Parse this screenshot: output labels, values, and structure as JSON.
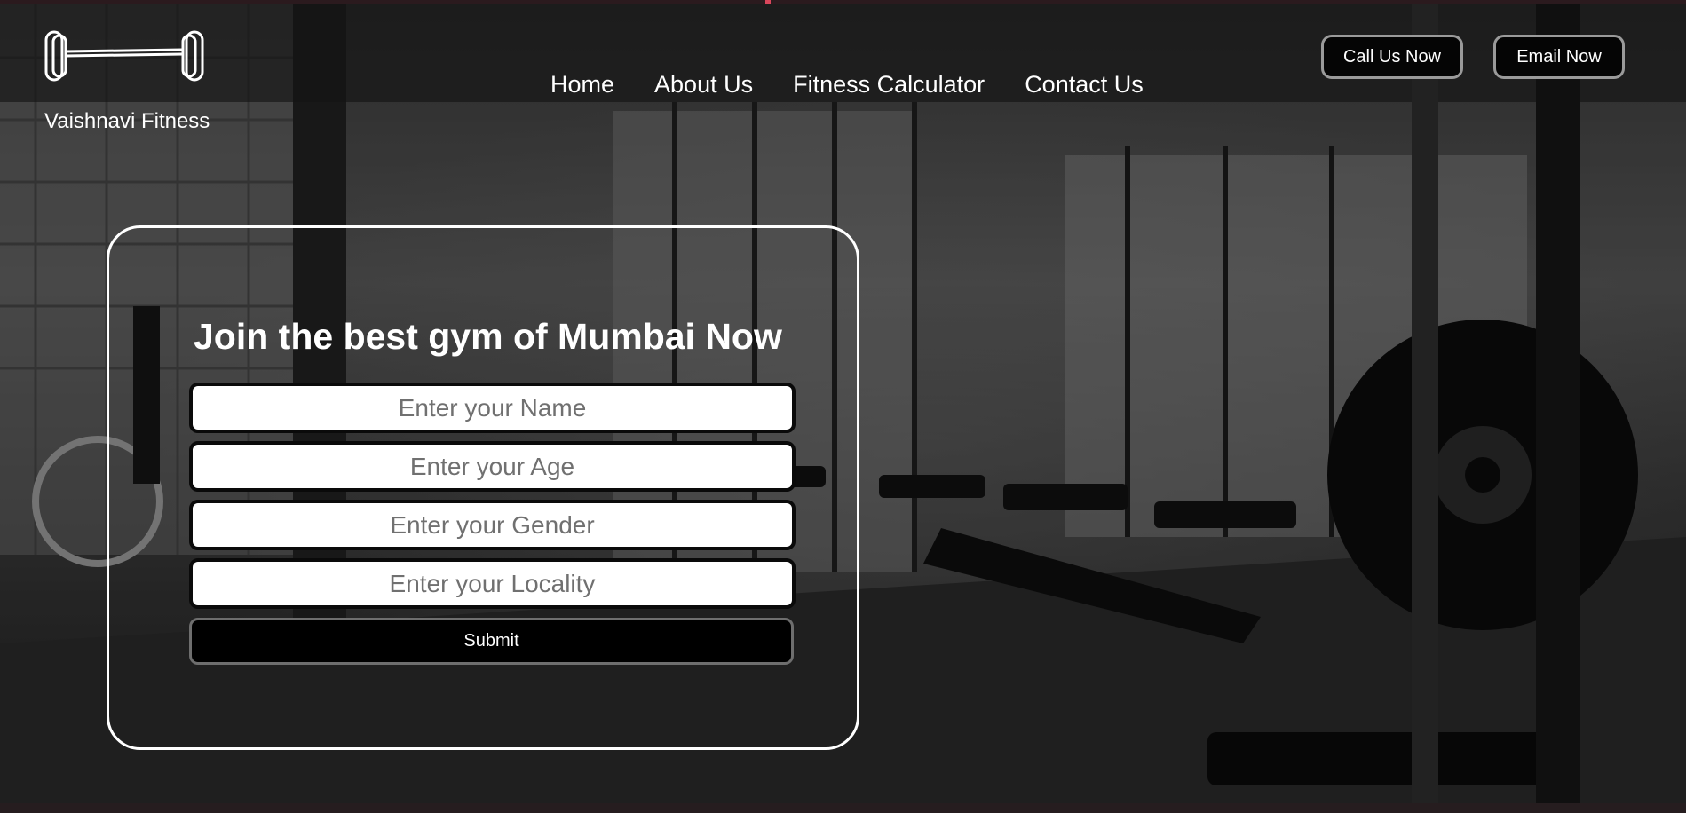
{
  "brand": {
    "name": "Vaishnavi Fitness",
    "logo_icon": "barbell-icon"
  },
  "nav": {
    "items": [
      {
        "label": "Home"
      },
      {
        "label": "About Us"
      },
      {
        "label": "Fitness Calculator"
      },
      {
        "label": "Contact Us"
      }
    ]
  },
  "header_buttons": {
    "call": "Call Us Now",
    "email": "Email Now"
  },
  "form": {
    "title": "Join the best gym of Mumbai Now",
    "fields": [
      {
        "placeholder": "Enter your Name",
        "value": ""
      },
      {
        "placeholder": "Enter your Age",
        "value": ""
      },
      {
        "placeholder": "Enter your Gender",
        "value": ""
      },
      {
        "placeholder": "Enter your Locality",
        "value": ""
      }
    ],
    "submit_label": "Submit"
  },
  "colors": {
    "accent": "#d9465b",
    "text": "#ffffff",
    "button_bg": "#000000"
  }
}
